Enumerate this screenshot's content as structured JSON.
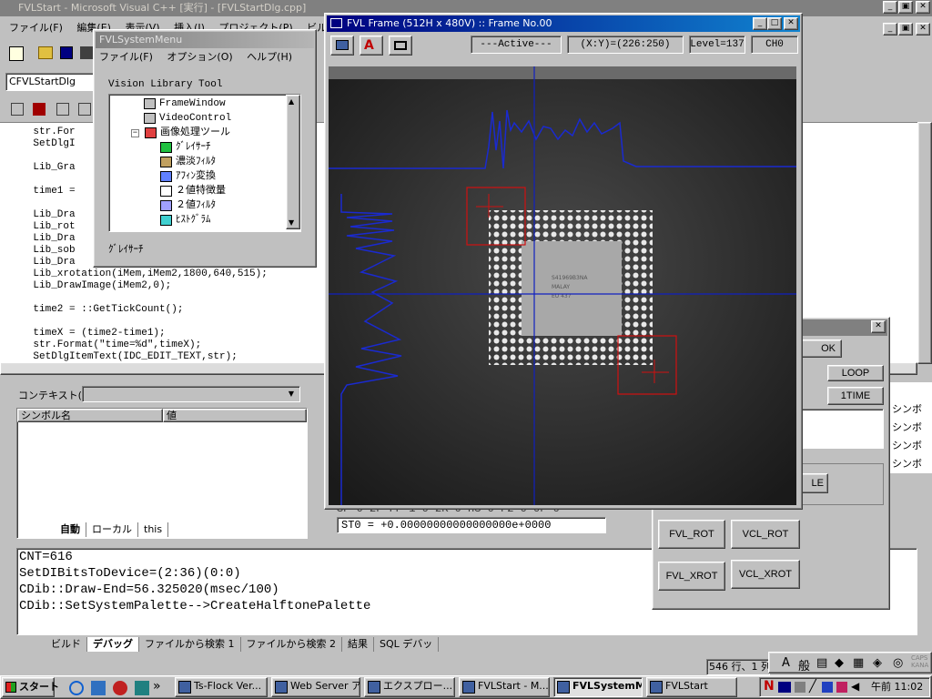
{
  "ide": {
    "title": "FVLStart - Microsoft Visual C++ [実行] - [FVLStartDlg.cpp]",
    "menu": [
      "ファイル(F)",
      "編集(E)",
      "表示(V)",
      "挿入(I)",
      "プロジェクト(P)",
      "ビルド(B)"
    ],
    "class_combo": "CFVLStartDlg",
    "code_lines": [
      "    str.For",
      "    SetDlgI",
      "",
      "    Lib_Gra",
      "",
      "    time1 =",
      "",
      "    Lib_Dra",
      "    Lib_rot",
      "    Lib_Dra",
      "    Lib_sob",
      "    Lib_Dra",
      "    Lib_xrotation(iMem,iMem2,1800,640,515);",
      "    Lib_DrawImage(iMem2,0);",
      "",
      "    time2 = ::GetTickCount();",
      "",
      "    timeX = (time2-time1);",
      "    str.Format(\"time=%d\",timeX);",
      "    SetDlgItemText(IDC_EDIT_TEXT,str);"
    ],
    "context_label": "コンテキスト(O):",
    "watch_headers": [
      "シンボル名",
      "値"
    ],
    "watch_tabs": [
      "自動",
      "ローカル",
      "this"
    ],
    "register_lines": [
      "SP 0 2F FP 1 0 2K 0 HS 0 F2 0 0F 0",
      "ST0 = +0.00000000000000000e+0000"
    ],
    "output_lines": [
      "CNT=616",
      "SetDIBitsToDevice=(2:36)(0:0)",
      "CDib::Draw-End=56.325020(msec/100)",
      "CDib::SetSystemPalette-->CreateHalftonePalette"
    ],
    "output_tabs": [
      "ビルド",
      "デバッグ",
      "ファイルから検索 1",
      "ファイルから検索 2",
      "結果",
      "SQL デバッ"
    ],
    "status_pos": "546 行、1 列",
    "right_list": [
      "シンボ",
      "シンボ",
      "シンボ",
      "シンボ"
    ]
  },
  "sysmenu": {
    "title": "FVLSystemMenu",
    "menu": [
      "ファイル(F)",
      "オプション(O)",
      "ヘルプ(H)"
    ],
    "group_label": "Vision Library Tool",
    "tree": [
      {
        "label": "FrameWindow",
        "indent": 0,
        "icon": "frame-window-icon"
      },
      {
        "label": "VideoControl",
        "indent": 0,
        "icon": "video-control-icon"
      },
      {
        "label": "画像処理ツール",
        "indent": -1,
        "icon": "image-tool-folder-icon"
      },
      {
        "label": "ｸﾞﾚｲｻｰﾁ",
        "indent": 1,
        "icon": "gray-search-icon"
      },
      {
        "label": "濃淡ﾌｨﾙﾀ",
        "indent": 1,
        "icon": "gray-filter-icon"
      },
      {
        "label": "ｱﾌｨﾝ変換",
        "indent": 1,
        "icon": "affine-icon"
      },
      {
        "label": "２値特徴量",
        "indent": 1,
        "icon": "binary-feature-icon"
      },
      {
        "label": "２値ﾌｨﾙﾀ",
        "indent": 1,
        "icon": "binary-filter-icon"
      },
      {
        "label": "ﾋｽﾄｸﾞﾗﾑ",
        "indent": 1,
        "icon": "histogram-icon"
      }
    ],
    "selected_label": "ｸﾞﾚｲｻｰﾁ"
  },
  "frame": {
    "title": "FVL Frame (512H x 480V) :: Frame No.00",
    "status": "---Active---",
    "coords": "(X:Y)=(226:250)",
    "level": "Level=137",
    "channel": "CH0",
    "chip_text": [
      "S41969B3NA",
      "MALAY",
      "EU      437"
    ]
  },
  "dialog": {
    "buttons_top": [
      "OK",
      "LOOP",
      "1TIME"
    ],
    "partial_left": [
      "LE"
    ],
    "fvl_rot": "FVL_ROT",
    "vcl_rot": "VCL_ROT",
    "fvl_xrot": "FVL_XROT",
    "vcl_xrot": "VCL_XROT"
  },
  "taskbar": {
    "start": "スタート",
    "tasks": [
      "Ts-Flock Ver...",
      "Web Server ア...",
      "エクスプロー...",
      "FVLStart - M...",
      "FVLSystemMe...",
      "FVLStart"
    ],
    "active_index": 4,
    "clock": "午前 11:02"
  }
}
